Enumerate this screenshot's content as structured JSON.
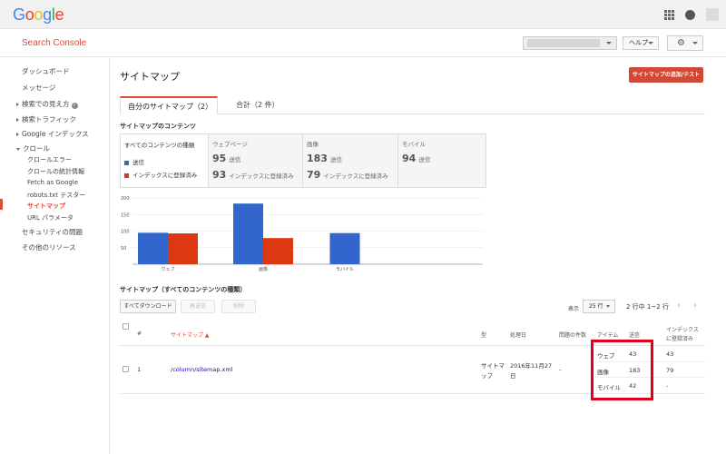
{
  "header": {
    "logo_letters": [
      {
        "ch": "G",
        "color": "#4285f4"
      },
      {
        "ch": "o",
        "color": "#ea4335"
      },
      {
        "ch": "o",
        "color": "#fbbc05"
      },
      {
        "ch": "g",
        "color": "#4285f4"
      },
      {
        "ch": "l",
        "color": "#34a853"
      },
      {
        "ch": "e",
        "color": "#ea4335"
      }
    ],
    "icons": [
      "apps-icon",
      "notifications-icon",
      "avatar"
    ]
  },
  "subheader": {
    "product_name": "Search Console",
    "help_label": "ヘルプ",
    "settings_icon": "gear-icon"
  },
  "sidebar": {
    "items": [
      {
        "label": "ダッシュボード"
      },
      {
        "label": "メッセージ"
      },
      {
        "label": "検索での見え方"
      },
      {
        "label": "検索トラフィック"
      },
      {
        "label": "Google インデックス"
      },
      {
        "label": "クロール"
      },
      {
        "label": "クロールエラー"
      },
      {
        "label": "クロールの統計情報"
      },
      {
        "label": "Fetch as Google"
      },
      {
        "label": "robots.txt テスター"
      },
      {
        "label": "サイトマップ"
      },
      {
        "label": "URL パラメータ"
      },
      {
        "label": "セキュリティの問題"
      },
      {
        "label": "その他のリソース"
      }
    ]
  },
  "page": {
    "title": "サイトマップ",
    "add_test_button": "サイトマップの追加/テスト"
  },
  "tabs": [
    {
      "label": "自分のサイトマップ（2）"
    },
    {
      "label": "合計（2 件）"
    }
  ],
  "contents": {
    "section_label": "サイトマップのコンテンツ",
    "selector_title": "すべてのコンテンツの種類",
    "legend_submitted": "送信",
    "legend_indexed": "インデックスに登録済み",
    "submitted_label": "送信",
    "indexed_label": "インデックスに登録済み",
    "colors": {
      "submitted": "#3366cc",
      "indexed": "#dc3912"
    },
    "types": [
      {
        "name": "ウェブページ",
        "submitted": "95",
        "indexed": "93"
      },
      {
        "name": "画像",
        "submitted": "183",
        "indexed": "79"
      },
      {
        "name": "モバイル",
        "submitted": "94",
        "indexed": ""
      }
    ]
  },
  "chart_data": {
    "type": "bar",
    "categories": [
      "ウェブ",
      "画像",
      "モバイル"
    ],
    "series": [
      {
        "name": "送信",
        "values": [
          95,
          183,
          94
        ],
        "color": "#3366cc"
      },
      {
        "name": "インデックスに登録済み",
        "values": [
          93,
          79,
          null
        ],
        "color": "#dc3912"
      }
    ],
    "yticks": [
      50,
      100,
      150,
      200
    ],
    "ylim": [
      0,
      200
    ],
    "grid": true
  },
  "table": {
    "section_label": "サイトマップ（すべてのコンテンツの種類）",
    "download_all": "すべてダウンロード",
    "resubmit": "再送信",
    "delete": "削除",
    "display_label": "表示",
    "rows_per_page": "25 行",
    "range_text": "2 行中 1~2 行",
    "headers": {
      "num": "#",
      "sitemap": "サイトマップ ▲",
      "type": "型",
      "processed": "処理日",
      "issues": "問題の件数",
      "items": "アイテム",
      "submitted": "送信",
      "indexed_line1": "インデックス",
      "indexed_line2": "に登録済み"
    },
    "row": {
      "num": "1",
      "path": "/column/sitemap.xml",
      "type_line1": "サイトマ",
      "type_line2": "ップ",
      "date_line1": "2016年11月27",
      "date_line2": "日",
      "issues": "-",
      "items": [
        {
          "name": "ウェブ",
          "submitted": "43",
          "indexed": "43"
        },
        {
          "name": "画像",
          "submitted": "183",
          "indexed": "79"
        },
        {
          "name": "モバイル",
          "submitted": "42",
          "indexed": "-"
        }
      ]
    }
  }
}
